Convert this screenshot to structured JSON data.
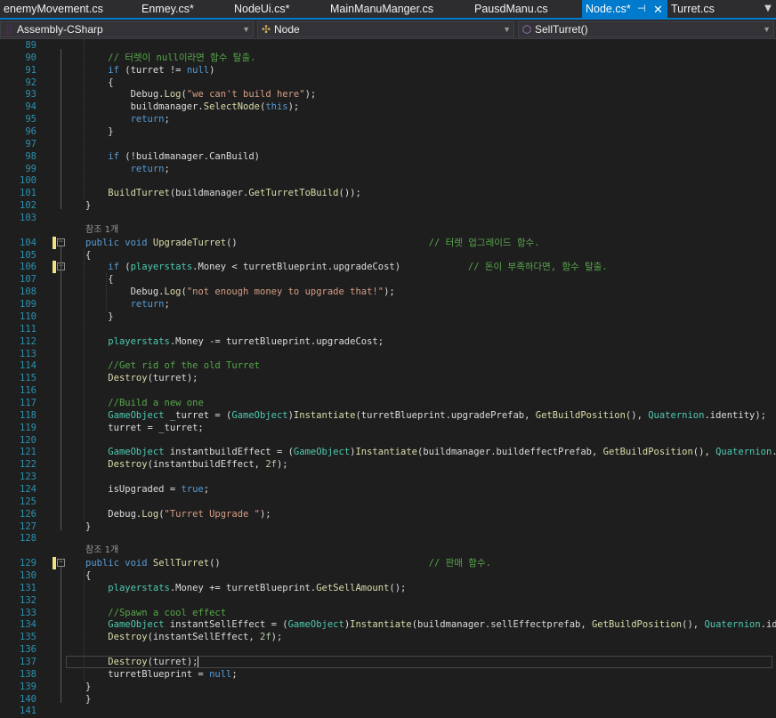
{
  "tabs": [
    {
      "label": "enemyMovement.cs",
      "active": false
    },
    {
      "label": "Enmey.cs*",
      "active": false
    },
    {
      "label": "NodeUi.cs*",
      "active": false
    },
    {
      "label": "MainManuManger.cs",
      "active": false
    },
    {
      "label": "PausdManu.cs",
      "active": false
    },
    {
      "label": "Node.cs*",
      "active": true
    },
    {
      "label": "Turret.cs",
      "active": false
    }
  ],
  "nav": {
    "project": "Assembly-CSharp",
    "type": "Node",
    "member": "SellTurret()"
  },
  "reference_label": "참조 1개",
  "lines": [
    {
      "n": "89",
      "tokens": []
    },
    {
      "n": "90",
      "tokens": [
        [
          "    // 터렛이 null이라면 함수 탈출.",
          "c"
        ]
      ]
    },
    {
      "n": "91",
      "tokens": [
        [
          "    ",
          ""
        ],
        [
          "if",
          "k"
        ],
        [
          " (turret != ",
          ""
        ],
        [
          "null",
          "k"
        ],
        [
          ")",
          ""
        ]
      ]
    },
    {
      "n": "92",
      "tokens": [
        [
          "    {",
          ""
        ]
      ]
    },
    {
      "n": "93",
      "tokens": [
        [
          "        Debug.",
          ""
        ],
        [
          "Log",
          "m"
        ],
        [
          "(",
          ""
        ],
        [
          "\"we can't build here\"",
          "s"
        ],
        [
          ");",
          ""
        ]
      ]
    },
    {
      "n": "94",
      "tokens": [
        [
          "        buildmanager.",
          ""
        ],
        [
          "SelectNode",
          "m"
        ],
        [
          "(",
          ""
        ],
        [
          "this",
          "k"
        ],
        [
          ");",
          ""
        ]
      ]
    },
    {
      "n": "95",
      "tokens": [
        [
          "        ",
          ""
        ],
        [
          "return",
          "k"
        ],
        [
          ";",
          ""
        ]
      ]
    },
    {
      "n": "96",
      "tokens": [
        [
          "    }",
          ""
        ]
      ]
    },
    {
      "n": "97",
      "tokens": []
    },
    {
      "n": "98",
      "tokens": [
        [
          "    ",
          ""
        ],
        [
          "if",
          "k"
        ],
        [
          " (!buildmanager.CanBuild)",
          ""
        ]
      ]
    },
    {
      "n": "99",
      "tokens": [
        [
          "        ",
          ""
        ],
        [
          "return",
          "k"
        ],
        [
          ";",
          ""
        ]
      ]
    },
    {
      "n": "100",
      "tokens": []
    },
    {
      "n": "101",
      "tokens": [
        [
          "    ",
          ""
        ],
        [
          "BuildTurret",
          "m"
        ],
        [
          "(buildmanager.",
          ""
        ],
        [
          "GetTurretToBuild",
          "m"
        ],
        [
          "());",
          ""
        ]
      ]
    },
    {
      "n": "102",
      "tokens": [
        [
          "}",
          ""
        ]
      ]
    },
    {
      "n": "103",
      "tokens": []
    },
    {
      "n": "104",
      "ref": true,
      "changed": true,
      "fold": true,
      "tokens": [
        [
          "public",
          "k"
        ],
        [
          " ",
          ""
        ],
        [
          "void",
          "k"
        ],
        [
          " ",
          ""
        ],
        [
          "UpgradeTurret",
          "m"
        ],
        [
          "()                                  ",
          ""
        ],
        [
          "// 터렛 업그레이드 함수.",
          "c"
        ]
      ]
    },
    {
      "n": "105",
      "tokens": [
        [
          "{",
          ""
        ]
      ]
    },
    {
      "n": "106",
      "changed": true,
      "fold": true,
      "tokens": [
        [
          "    ",
          ""
        ],
        [
          "if",
          "k"
        ],
        [
          " (",
          ""
        ],
        [
          "playerstats",
          "t"
        ],
        [
          ".Money < turretBlueprint.upgradeCost)            ",
          ""
        ],
        [
          "// 돈이 부족하다면, 함수 탈출.",
          "c"
        ]
      ]
    },
    {
      "n": "107",
      "tokens": [
        [
          "    {",
          ""
        ]
      ]
    },
    {
      "n": "108",
      "tokens": [
        [
          "        Debug.",
          ""
        ],
        [
          "Log",
          "m"
        ],
        [
          "(",
          ""
        ],
        [
          "\"not enough money to upgrade that!\"",
          "s"
        ],
        [
          ");",
          ""
        ]
      ]
    },
    {
      "n": "109",
      "tokens": [
        [
          "        ",
          ""
        ],
        [
          "return",
          "k"
        ],
        [
          ";",
          ""
        ]
      ]
    },
    {
      "n": "110",
      "tokens": [
        [
          "    }",
          ""
        ]
      ]
    },
    {
      "n": "111",
      "tokens": []
    },
    {
      "n": "112",
      "tokens": [
        [
          "    ",
          ""
        ],
        [
          "playerstats",
          "t"
        ],
        [
          ".Money -= turretBlueprint.upgradeCost;",
          ""
        ]
      ]
    },
    {
      "n": "113",
      "tokens": []
    },
    {
      "n": "114",
      "tokens": [
        [
          "    ",
          ""
        ],
        [
          "//Get rid of the old Turret",
          "c"
        ]
      ]
    },
    {
      "n": "115",
      "tokens": [
        [
          "    ",
          ""
        ],
        [
          "Destroy",
          "m"
        ],
        [
          "(turret);",
          ""
        ]
      ]
    },
    {
      "n": "116",
      "tokens": []
    },
    {
      "n": "117",
      "tokens": [
        [
          "    ",
          ""
        ],
        [
          "//Build a new one",
          "c"
        ]
      ]
    },
    {
      "n": "118",
      "tokens": [
        [
          "    ",
          ""
        ],
        [
          "GameObject",
          "t"
        ],
        [
          " _turret = (",
          ""
        ],
        [
          "GameObject",
          "t"
        ],
        [
          ")",
          ""
        ],
        [
          "Instantiate",
          "m"
        ],
        [
          "(turretBlueprint.upgradePrefab, ",
          ""
        ],
        [
          "GetBuildPosition",
          "m"
        ],
        [
          "(), ",
          ""
        ],
        [
          "Quaternion",
          "t"
        ],
        [
          ".identity);",
          ""
        ]
      ]
    },
    {
      "n": "119",
      "tokens": [
        [
          "    turret = _turret;",
          ""
        ]
      ]
    },
    {
      "n": "120",
      "tokens": []
    },
    {
      "n": "121",
      "tokens": [
        [
          "    ",
          ""
        ],
        [
          "GameObject",
          "t"
        ],
        [
          " instantbuildEffect = (",
          ""
        ],
        [
          "GameObject",
          "t"
        ],
        [
          ")",
          ""
        ],
        [
          "Instantiate",
          "m"
        ],
        [
          "(buildmanager.buildeffectPrefab, ",
          ""
        ],
        [
          "GetBuildPosition",
          "m"
        ],
        [
          "(), ",
          ""
        ],
        [
          "Quaternion",
          "t"
        ],
        [
          ".identity);",
          ""
        ]
      ]
    },
    {
      "n": "122",
      "tokens": [
        [
          "    ",
          ""
        ],
        [
          "Destroy",
          "m"
        ],
        [
          "(instantbuildEffect, ",
          ""
        ],
        [
          "2f",
          "n"
        ],
        [
          ");",
          ""
        ]
      ]
    },
    {
      "n": "123",
      "tokens": []
    },
    {
      "n": "124",
      "tokens": [
        [
          "    isUpgraded = ",
          ""
        ],
        [
          "true",
          "k"
        ],
        [
          ";",
          ""
        ]
      ]
    },
    {
      "n": "125",
      "tokens": []
    },
    {
      "n": "126",
      "tokens": [
        [
          "    Debug.",
          ""
        ],
        [
          "Log",
          "m"
        ],
        [
          "(",
          ""
        ],
        [
          "\"Turret Upgrade \"",
          "s"
        ],
        [
          ");",
          ""
        ]
      ]
    },
    {
      "n": "127",
      "tokens": [
        [
          "}",
          ""
        ]
      ]
    },
    {
      "n": "128",
      "tokens": []
    },
    {
      "n": "129",
      "ref": true,
      "changed": true,
      "fold": true,
      "tokens": [
        [
          "public",
          "k"
        ],
        [
          " ",
          ""
        ],
        [
          "void",
          "k"
        ],
        [
          " ",
          ""
        ],
        [
          "SellTurret",
          "m"
        ],
        [
          "()                                     ",
          ""
        ],
        [
          "// 판매 함수.",
          "c"
        ]
      ]
    },
    {
      "n": "130",
      "tokens": [
        [
          "{",
          ""
        ]
      ]
    },
    {
      "n": "131",
      "tokens": [
        [
          "    ",
          ""
        ],
        [
          "playerstats",
          "t"
        ],
        [
          ".Money += turretBlueprint.",
          ""
        ],
        [
          "GetSellAmount",
          "m"
        ],
        [
          "();",
          ""
        ]
      ]
    },
    {
      "n": "132",
      "tokens": []
    },
    {
      "n": "133",
      "tokens": [
        [
          "    ",
          ""
        ],
        [
          "//Spawn a cool effect",
          "c"
        ]
      ]
    },
    {
      "n": "134",
      "tokens": [
        [
          "    ",
          ""
        ],
        [
          "GameObject",
          "t"
        ],
        [
          " instantSellEffect = (",
          ""
        ],
        [
          "GameObject",
          "t"
        ],
        [
          ")",
          ""
        ],
        [
          "Instantiate",
          "m"
        ],
        [
          "(buildmanager.sellEffectprefab, ",
          ""
        ],
        [
          "GetBuildPosition",
          "m"
        ],
        [
          "(), ",
          ""
        ],
        [
          "Quaternion",
          "t"
        ],
        [
          ".identity);",
          ""
        ]
      ]
    },
    {
      "n": "135",
      "tokens": [
        [
          "    ",
          ""
        ],
        [
          "Destroy",
          "m"
        ],
        [
          "(instantSellEffect, ",
          ""
        ],
        [
          "2f",
          "n"
        ],
        [
          ");",
          ""
        ]
      ]
    },
    {
      "n": "136",
      "tokens": []
    },
    {
      "n": "137",
      "current": true,
      "tokens": [
        [
          "    ",
          ""
        ],
        [
          "Destroy",
          "m"
        ],
        [
          "(turret);",
          ""
        ]
      ]
    },
    {
      "n": "138",
      "tokens": [
        [
          "    turretBlueprint = ",
          ""
        ],
        [
          "null",
          "k"
        ],
        [
          ";",
          ""
        ]
      ]
    },
    {
      "n": "139",
      "tokens": [
        [
          "}",
          ""
        ]
      ]
    },
    {
      "n": "140",
      "tokens": [
        [
          "}",
          ""
        ]
      ]
    },
    {
      "n": "141",
      "tokens": []
    }
  ]
}
